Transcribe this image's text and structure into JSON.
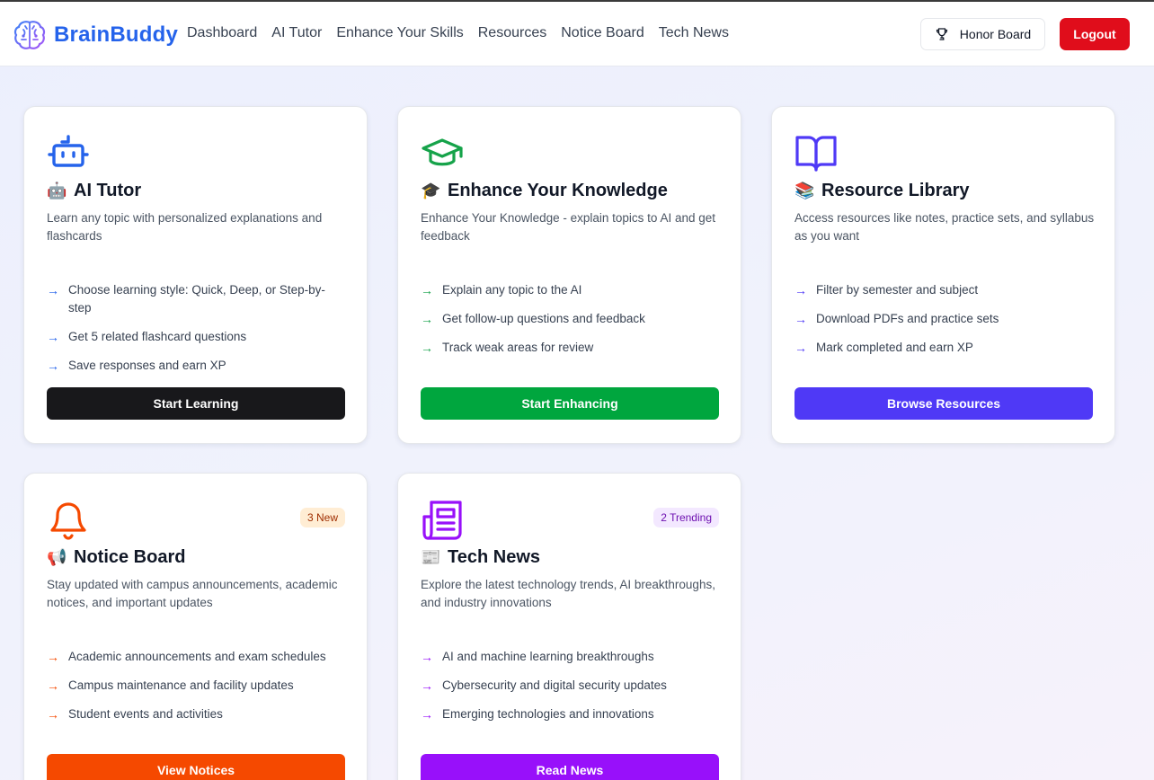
{
  "header": {
    "brand": "BrainBuddy",
    "nav": [
      "Dashboard",
      "AI Tutor",
      "Enhance Your Skills",
      "Resources",
      "Notice Board",
      "Tech News"
    ],
    "honor_board": "Honor Board",
    "logout": "Logout"
  },
  "cards": [
    {
      "icon": "robot-icon",
      "emoji": "🤖",
      "title": "AI Tutor",
      "description": "Learn any topic with personalized explanations and flashcards",
      "features": [
        "Choose learning style: Quick, Deep, or Step-by-step",
        "Get 5 related flashcard questions",
        "Save responses and earn XP"
      ],
      "button": "Start Learning",
      "accent": "#2563eb",
      "button_color": "#18181b"
    },
    {
      "icon": "graduation-cap-icon",
      "emoji": "🎓",
      "title": "Enhance Your Knowledge",
      "description": "Enhance Your Knowledge - explain topics to AI and get feedback",
      "features": [
        "Explain any topic to the AI",
        "Get follow-up questions and feedback",
        "Track weak areas for review"
      ],
      "button": "Start Enhancing",
      "accent": "#16a34a",
      "button_color": "#00a63e"
    },
    {
      "icon": "book-open-icon",
      "emoji": "📚",
      "title": "Resource Library",
      "description": "Access resources like notes, practice sets, and syllabus as you want",
      "features": [
        "Filter by semester and subject",
        "Download PDFs and practice sets",
        "Mark completed and earn XP"
      ],
      "button": "Browse Resources",
      "accent": "#4f39f6",
      "button_color": "#4f39f6"
    },
    {
      "icon": "bell-icon",
      "emoji": "📢",
      "title": "Notice Board",
      "description": "Stay updated with campus announcements, academic notices, and important updates",
      "features": [
        "Academic announcements and exam schedules",
        "Campus maintenance and facility updates",
        "Student events and activities"
      ],
      "button": "View Notices",
      "badge": "3 New",
      "accent": "#f54900",
      "button_color": "#f54900"
    },
    {
      "icon": "newspaper-icon",
      "emoji": "📰",
      "title": "Tech News",
      "description": "Explore the latest technology trends, AI breakthroughs, and industry innovations",
      "features": [
        "AI and machine learning breakthroughs",
        "Cybersecurity and digital security updates",
        "Emerging technologies and innovations"
      ],
      "button": "Read News",
      "badge": "2 Trending",
      "accent": "#9810fa",
      "button_color": "#9810fa"
    }
  ]
}
